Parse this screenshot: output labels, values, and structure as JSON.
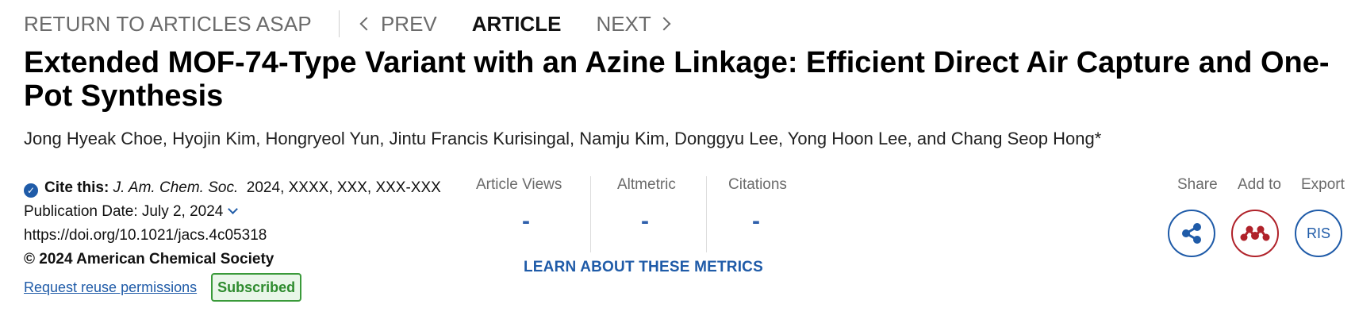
{
  "nav": {
    "return_label": "RETURN TO ARTICLES ASAP",
    "prev_label": "PREV",
    "article_label": "ARTICLE",
    "next_label": "NEXT"
  },
  "article": {
    "title": "Extended MOF-74-Type Variant with an Azine Linkage: Efficient Direct Air Capture and One-Pot Synthesis",
    "authors": "Jong Hyeak Choe, Hyojin Kim, Hongryeol Yun, Jintu Francis Kurisingal, Namju Kim, Donggyu Lee, Yong Hoon Lee, and Chang Seop Hong*"
  },
  "cite": {
    "label": "Cite this:",
    "journal": "J. Am. Chem. Soc.",
    "ref": "2024, XXXX, XXX, XXX-XXX",
    "pub_date": "Publication Date: July 2, 2024",
    "doi": "https://doi.org/10.1021/jacs.4c05318",
    "copyright": "© 2024 American Chemical Society",
    "reuse_link": "Request reuse permissions",
    "badge": "Subscribed"
  },
  "metrics": {
    "items": [
      {
        "label": "Article Views",
        "value": "-"
      },
      {
        "label": "Altmetric",
        "value": "-"
      },
      {
        "label": "Citations",
        "value": "-"
      }
    ],
    "learn_link": "LEARN ABOUT THESE METRICS"
  },
  "actions": {
    "share_label": "Share",
    "addto_label": "Add to",
    "export_label": "Export",
    "ris_label": "RIS"
  },
  "colors": {
    "accent": "#1f5ba8",
    "mendeley": "#b0222a",
    "subscribed": "#2e8b2e"
  }
}
